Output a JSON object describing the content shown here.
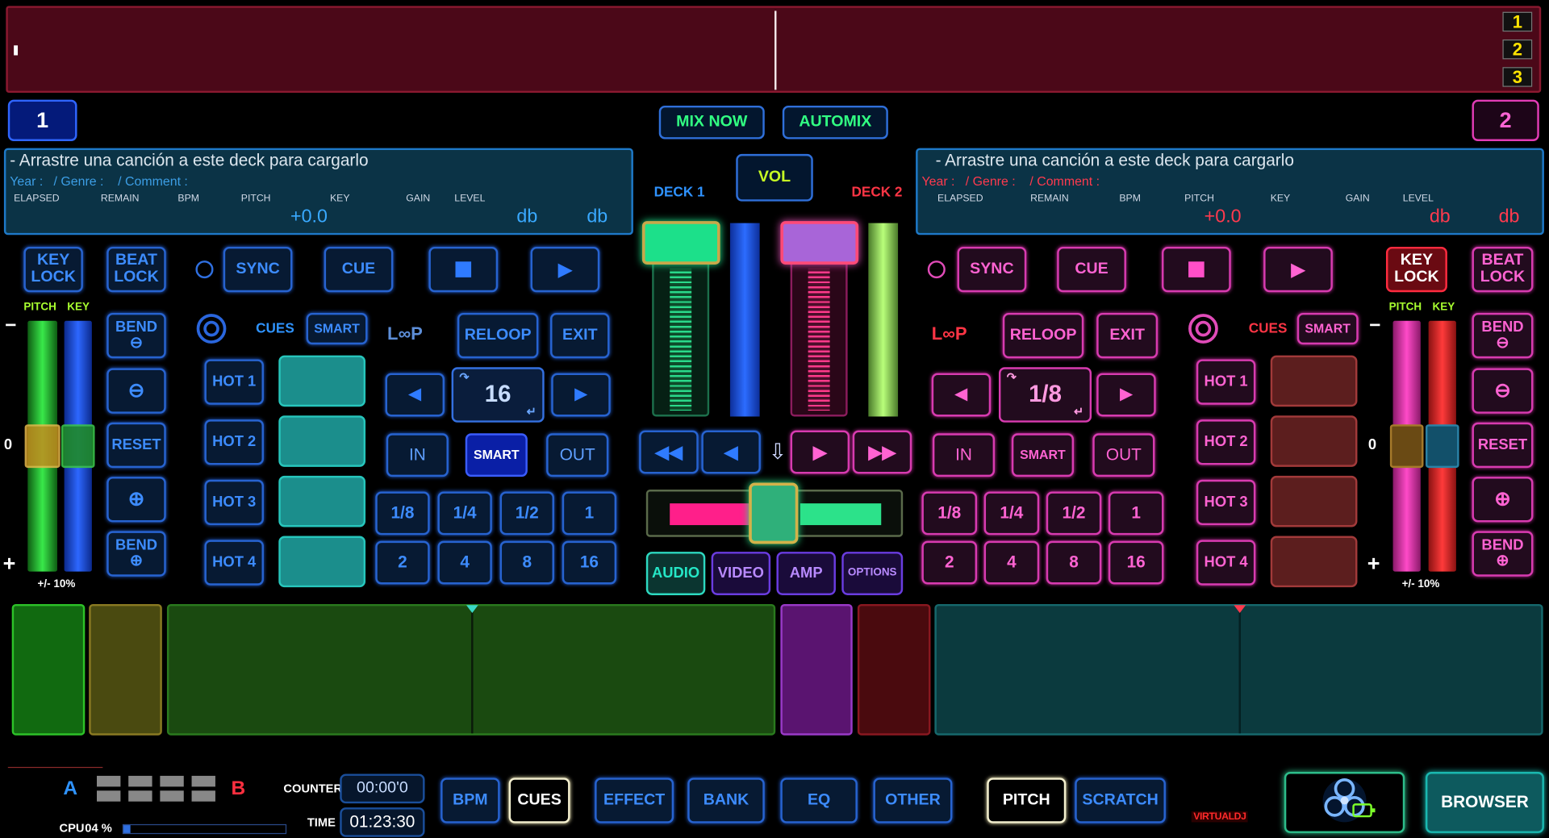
{
  "waveform": {
    "hot_cues": [
      "1",
      "2",
      "3"
    ]
  },
  "header": {
    "deck1_number": "1",
    "deck2_number": "2",
    "mix_now": "MIX NOW",
    "automix": "AUTOMIX",
    "vol": "VOL",
    "deck1_label": "DECK 1",
    "deck2_label": "DECK 2"
  },
  "deck1": {
    "title": "- Arrastre una canción a este deck para cargarlo",
    "meta": "Year :   / Genre :    / Comment :",
    "col_labels": [
      "ELAPSED",
      "REMAIN",
      "BPM",
      "PITCH",
      "KEY",
      "GAIN",
      "LEVEL"
    ],
    "pitch_value": "+0.0",
    "gain_value": "db",
    "level_value": "db",
    "key_lock": "KEY LOCK",
    "beat_lock": "BEAT LOCK",
    "pitch_label": "PITCH",
    "key_label": "KEY",
    "minus": "−",
    "zero": "0",
    "plus": "+",
    "range": "+/- 10%",
    "bend": "BEND",
    "reset": "RESET",
    "sync": "SYNC",
    "cue": "CUE",
    "cues_label": "CUES",
    "smart": "SMART",
    "loop_label": "L∞P",
    "reloop": "RELOOP",
    "exit": "EXIT",
    "loop_value": "16",
    "in": "IN",
    "smart2": "SMART",
    "out": "OUT",
    "hot": [
      "HOT 1",
      "HOT 2",
      "HOT 3",
      "HOT 4"
    ],
    "loop_sizes": [
      "1/8",
      "1/4",
      "1/2",
      "1",
      "2",
      "4",
      "8",
      "16"
    ]
  },
  "deck2": {
    "title": "- Arrastre una canción a este deck para cargarlo",
    "meta": "Year :   / Genre :    / Comment :",
    "col_labels": [
      "ELAPSED",
      "REMAIN",
      "BPM",
      "PITCH",
      "KEY",
      "GAIN",
      "LEVEL"
    ],
    "pitch_value": "+0.0",
    "gain_value": "db",
    "level_value": "db",
    "key_lock": "KEY LOCK",
    "beat_lock": "BEAT LOCK",
    "pitch_label": "PITCH",
    "key_label": "KEY",
    "minus": "−",
    "zero": "0",
    "plus": "+",
    "range": "+/- 10%",
    "bend": "BEND",
    "reset": "RESET",
    "sync": "SYNC",
    "cue": "CUE",
    "cues_label": "CUES",
    "smart": "SMART",
    "loop_label": "L∞P",
    "reloop": "RELOOP",
    "exit": "EXIT",
    "loop_value": "1/8",
    "in": "IN",
    "smart2": "SMART",
    "out": "OUT",
    "hot": [
      "HOT 1",
      "HOT 2",
      "HOT 3",
      "HOT 4"
    ],
    "loop_sizes": [
      "1/8",
      "1/4",
      "1/2",
      "1",
      "2",
      "4",
      "8",
      "16"
    ]
  },
  "mixer": {
    "tabs": [
      "AUDIO",
      "VIDEO",
      "AMP",
      "OPTIONS"
    ]
  },
  "footer": {
    "a": "A",
    "b": "B",
    "counter_label": "COUNTER",
    "counter_value": "00:00'0",
    "time_label": "TIME",
    "time_value": "01:23:30",
    "cpu_label": "CPU",
    "cpu_value": "04 %",
    "tabs": [
      "BPM",
      "CUES",
      "EFFECT",
      "BANK",
      "EQ",
      "OTHER"
    ],
    "tabs2": [
      "PITCH",
      "SCRATCH"
    ],
    "brand": "VIRTUALDJ",
    "browser": "BROWSER"
  },
  "colors": {
    "deck1_accent": "#2f7bff",
    "deck2_accent": "#ff4fc8",
    "teal": "#25e6c6",
    "waveform_bg": "#4b0818"
  }
}
